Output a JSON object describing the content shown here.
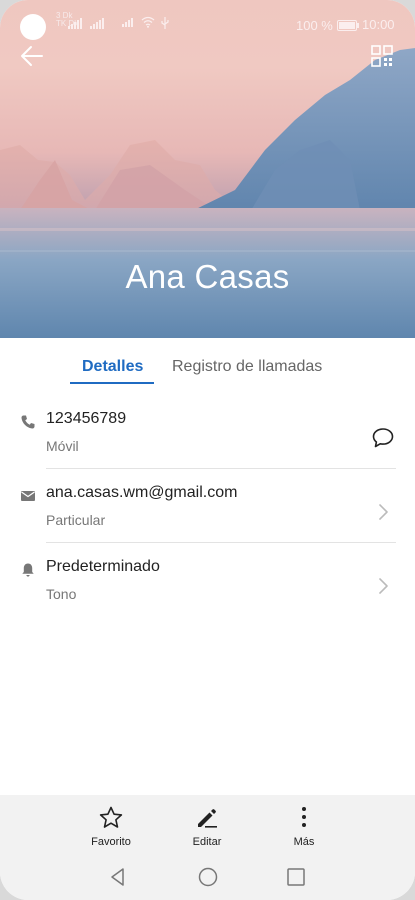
{
  "status_bar": {
    "network_label": "3 Dk\nTK Dk",
    "battery_percent": "100 %",
    "battery_level": 1.0,
    "time": "10:00"
  },
  "header": {
    "contact_name": "Ana Casas",
    "back_icon": "arrow-left-icon",
    "qr_icon": "qr-code-icon"
  },
  "tabs": [
    {
      "label": "Detalles",
      "active": true
    },
    {
      "label": "Registro de llamadas",
      "active": false
    }
  ],
  "details": [
    {
      "icon": "phone-icon",
      "value": "123456789",
      "type": "Móvil",
      "action_icon": "message-icon"
    },
    {
      "icon": "mail-icon",
      "value": "ana.casas.wm@gmail.com",
      "type": "Particular",
      "action_icon": "chevron-right-icon"
    },
    {
      "icon": "bell-icon",
      "value": "Predeterminado",
      "type": "Tono",
      "action_icon": "chevron-right-icon"
    }
  ],
  "bottom_actions": [
    {
      "label": "Favorito",
      "icon": "star-icon"
    },
    {
      "label": "Editar",
      "icon": "edit-icon"
    },
    {
      "label": "Más",
      "icon": "more-vertical-icon"
    }
  ],
  "nav_bar": [
    "back-triangle-icon",
    "home-circle-icon",
    "recents-square-icon"
  ],
  "colors": {
    "accent": "#1f6bc2",
    "action_bar_bg": "#f2f2f2"
  }
}
